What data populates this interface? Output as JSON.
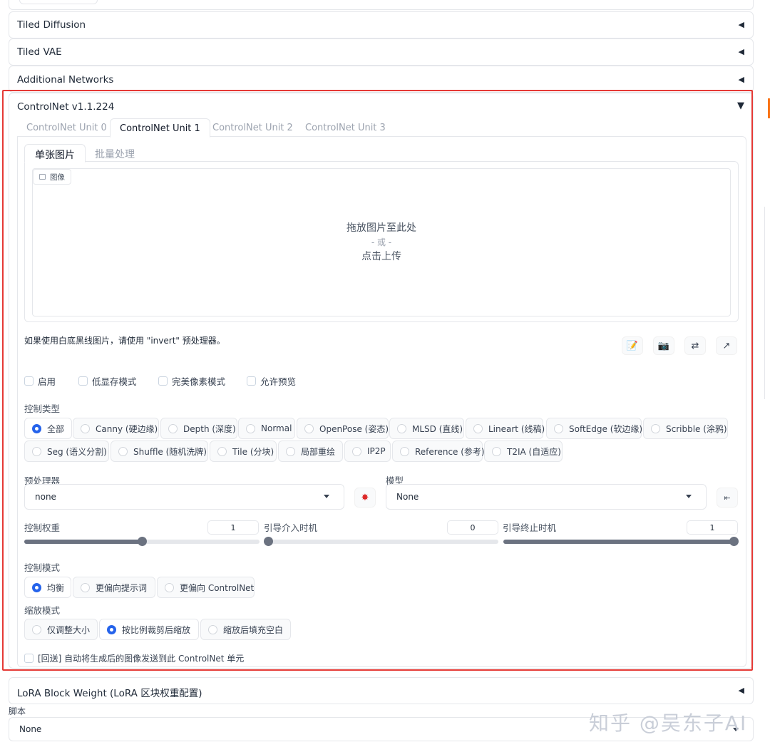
{
  "accordions": {
    "tiled_diffusion": "Tiled Diffusion",
    "tiled_vae": "Tiled VAE",
    "additional_networks": "Additional Networks",
    "lora_block_weight": "LoRA Block Weight (LoRA 区块权重配置)"
  },
  "controlnet": {
    "title": "ControlNet v1.1.224",
    "units": [
      "ControlNet Unit 0",
      "ControlNet Unit 1",
      "ControlNet Unit 2",
      "ControlNet Unit 3"
    ],
    "active_unit": 1,
    "image_tabs": [
      "单张图片",
      "批量处理"
    ],
    "image_label": "图像",
    "drop": {
      "line1": "拖放图片至此处",
      "line2": "- 或 -",
      "line3": "点击上传"
    },
    "invert_hint": "如果使用白底黑线图片，请使用 \"invert\" 预处理器。",
    "checkboxes": [
      "启用",
      "低显存模式",
      "完美像素模式",
      "允许预览"
    ],
    "control_type_label": "控制类型",
    "control_types": [
      "全部",
      "Canny (硬边缘)",
      "Depth (深度)",
      "Normal",
      "OpenPose (姿态)",
      "MLSD (直线)",
      "Lineart (线稿)",
      "SoftEdge (软边缘)",
      "Scribble (涂鸦)",
      "Seg (语义分割)",
      "Shuffle (随机洗牌)",
      "Tile (分块)",
      "局部重绘",
      "IP2P",
      "Reference (参考)",
      "T2IA (自适应)"
    ],
    "control_type_selected": "全部",
    "preprocessor_label": "预处理器",
    "preprocessor_value": "none",
    "model_label": "模型",
    "model_value": "None",
    "sliders": [
      {
        "label": "控制权重",
        "value": "1",
        "fraction": 0.5
      },
      {
        "label": "引导介入时机",
        "value": "0",
        "fraction": 0.0
      },
      {
        "label": "引导终止时机",
        "value": "1",
        "fraction": 1.0
      }
    ],
    "control_mode_label": "控制模式",
    "control_modes": [
      "均衡",
      "更偏向提示词",
      "更偏向 ControlNet"
    ],
    "control_mode_selected": "均衡",
    "resize_mode_label": "缩放模式",
    "resize_modes": [
      "仅调整大小",
      "按比例裁剪后缩放",
      "缩放后填充空白"
    ],
    "resize_mode_selected": "按比例裁剪后缩放",
    "loopback": "[回送] 自动将生成后的图像发送到此 ControlNet 单元"
  },
  "script": {
    "label": "脚本",
    "value": "None"
  },
  "watermark": "知乎 @吴东子AI",
  "icons": {
    "edit": "edit-icon",
    "camera": "camera-icon",
    "swap": "swap-icon",
    "send": "send-dimensions-icon",
    "run_preprocessor": "explosion-icon",
    "refresh_models": "refresh-models-icon"
  },
  "colors": {
    "highlight_frame": "#e53935",
    "radio_selected": "#2563eb"
  }
}
